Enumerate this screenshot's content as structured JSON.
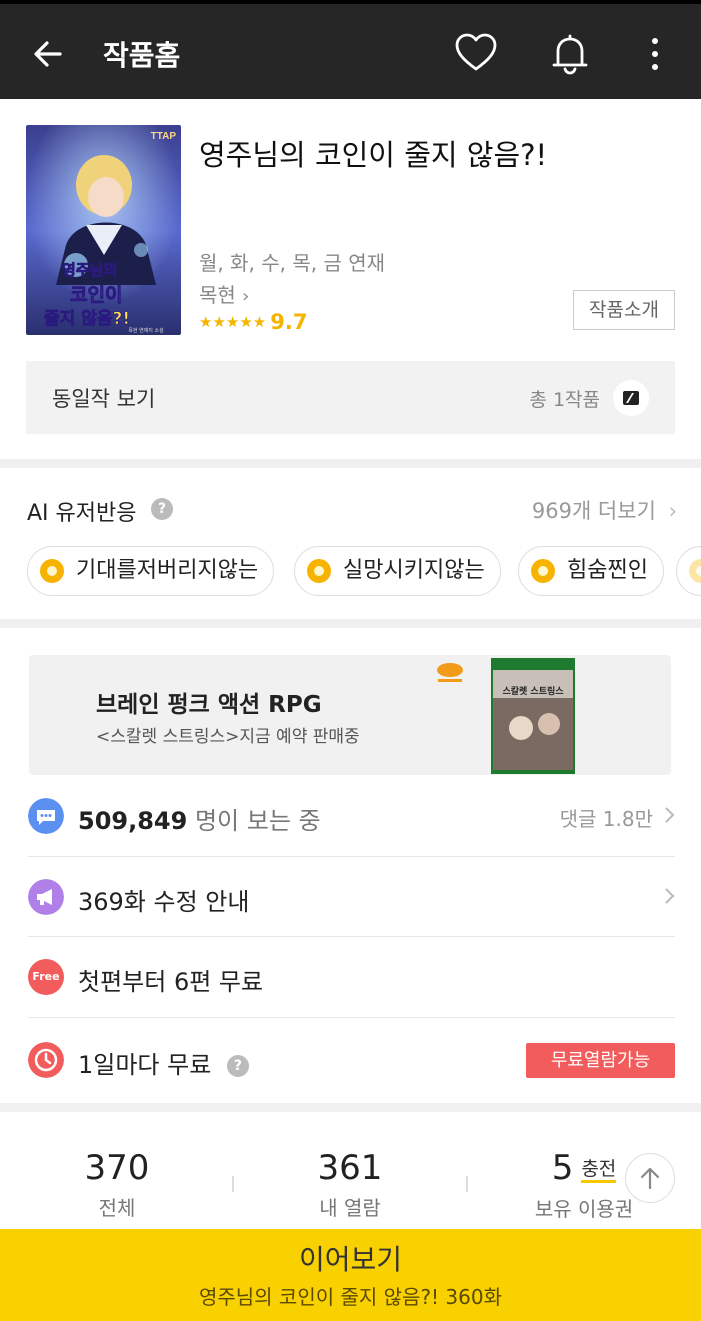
{
  "header": {
    "title": "작품홈",
    "bg_color": "#262626"
  },
  "work": {
    "cover_logo": "TTAP",
    "cover_title_lines": [
      "영주님의",
      "코인이",
      "줄지 않음?!"
    ],
    "cover_credit": "목현 연재지 소설",
    "title": "영주님의 코인이 줄지 않음?!",
    "schedule": "월, 화, 수, 목, 금 연재",
    "author": "목현",
    "stars": "★★★★★",
    "rating": "9.7",
    "intro_label": "작품소개"
  },
  "same_works": {
    "label": "동일작 보기",
    "count": "총 1작품"
  },
  "ai": {
    "title": "AI 유저반응",
    "help": "?",
    "more": "969개 더보기",
    "chips": [
      "기대를저버리지않는",
      "실망시키지않는",
      "힘숨찐인"
    ]
  },
  "ad": {
    "headline": "브레인 펑크 액션 RPG",
    "sub": "<스칼렛 스트링스>지금 예약 판매중",
    "box_title": "스칼렛 스트링스"
  },
  "rows": {
    "viewers_count": "509,849",
    "viewers_suffix": "명이 보는 중",
    "comments": "댓글 1.8만",
    "notice": "369화 수정 안내",
    "free_icon": "Free",
    "free_text": "첫편부터 6편 무료",
    "daily_text": "1일마다 무료",
    "daily_help": "?",
    "daily_btn": "무료열람가능"
  },
  "stats": {
    "total": "370",
    "total_label": "전체",
    "opened": "361",
    "opened_label": "내 열람",
    "tickets": "5",
    "charge": "충전",
    "tickets_label": "보유 이용권"
  },
  "continue": {
    "label": "이어보기",
    "episode": "영주님의 코인이 줄지 않음?! 360화"
  },
  "colors": {
    "accent_yellow": "#f9d000",
    "star": "#f5b400",
    "free_red": "#f25c5c",
    "chat_blue": "#5b8ff0",
    "notice_purple": "#b07fe8"
  }
}
